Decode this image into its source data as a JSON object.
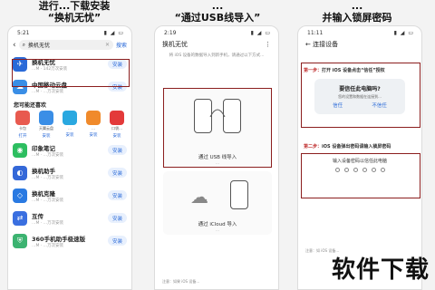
{
  "captions": {
    "left_line1": "进行...下载安装",
    "left_line2": "“换机无忧”",
    "mid_line1": "...",
    "mid_line2": "“通过USB线导入”",
    "right_line1": "...",
    "right_line2": "并输入锁屏密码"
  },
  "phone1": {
    "time": "5:21",
    "search_value": "换机无忧",
    "search_go": "搜索",
    "featured": {
      "name": "换机无忧",
      "meta": "…M · 142万次安装",
      "install": "安装"
    },
    "second": {
      "name": "中国移动云盘",
      "meta": "…M · …万次安装",
      "install": "安装"
    },
    "section": "您可能还喜欢",
    "grid": [
      {
        "label": "卡包",
        "btn": "打开",
        "color": "#e85a4f"
      },
      {
        "label": "天翼云盘",
        "btn": "安装",
        "color": "#3a8ee6"
      },
      {
        "label": "...",
        "btn": "安装",
        "color": "#2aa8e0"
      },
      {
        "label": "...",
        "btn": "安装",
        "color": "#f08a2b"
      },
      {
        "label": "口袋...",
        "btn": "安装",
        "color": "#e33a3a"
      }
    ],
    "apps": [
      {
        "name": "印象笔记",
        "meta": "…M · …万次安装",
        "install": "安装",
        "color": "#2dbe60"
      },
      {
        "name": "换机助手",
        "meta": "…M · …万次安装",
        "install": "安装",
        "color": "#3468d8"
      },
      {
        "name": "换机克隆",
        "meta": "…M · …万次安装",
        "install": "安装",
        "color": "#2a7ae2"
      },
      {
        "name": "互传",
        "meta": "…M · …万次安装",
        "install": "安装",
        "color": "#3a6fe0"
      },
      {
        "name": "360手机助手极速版",
        "meta": "…M · …万次安装",
        "install": "安装",
        "color": "#3cb371"
      }
    ]
  },
  "phone2": {
    "time": "2:19",
    "title": "换机无忧",
    "desc": "将 iOS 设备的数据导入到新手机，请通过以下方式...",
    "usb_label": "通过 USB 线导入",
    "usb_sub": "...",
    "icloud_label": "通过 iCloud 导入",
    "icloud_sub": "...",
    "note": "注意：如果 iOS 设备..."
  },
  "phone3": {
    "time": "11:11",
    "title": "连接设备",
    "step1_prefix": "第一步：",
    "step1_text": "打开 iOS 设备点击“信任”授权",
    "dialog_title": "要信任此电脑吗?",
    "dialog_desc": "您的设置和数据在连接到...",
    "btn_trust": "信任",
    "btn_no": "不信任",
    "step2_prefix": "第二步：",
    "step2_text": "iOS 设备弹出密码请输入锁屏密码",
    "pin_title": "输入设备密码以信任此电脑",
    "note": "注意：如 iOS 设备..."
  },
  "watermark": "软件下载"
}
